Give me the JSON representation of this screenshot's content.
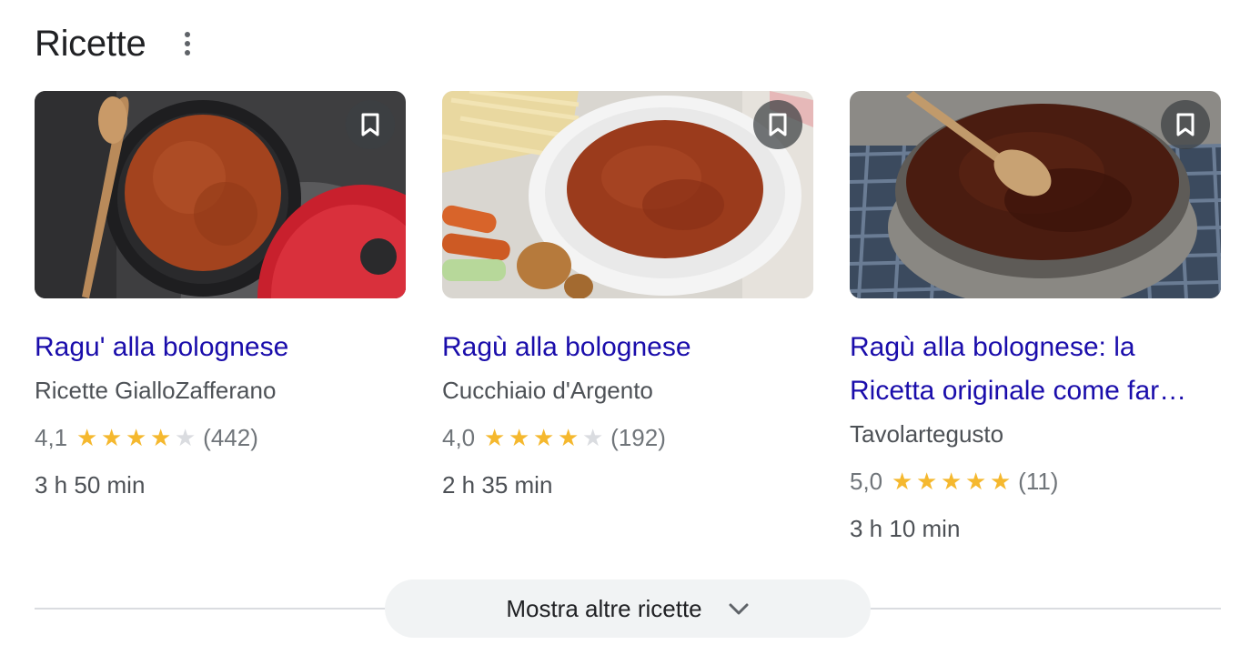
{
  "header": {
    "title": "Ricette",
    "menu_icon": "more-vert-icon"
  },
  "recipes": [
    {
      "title": "Ragu' alla bolognese",
      "source": "Ricette GialloZafferano",
      "rating_text": "4,1",
      "rating_value": 4.1,
      "stars_filled": 4,
      "reviews": "(442)",
      "time": "3 h 50 min",
      "image": "ragu-red-pot-with-wooden-spoon"
    },
    {
      "title": "Ragù alla bolognese",
      "source": "Cucchiaio d'Argento",
      "rating_text": "4,0",
      "rating_value": 4.0,
      "stars_filled": 4,
      "reviews": "(192)",
      "time": "2 h 35 min",
      "image": "ragu-white-dish-with-pasta-and-vegetables"
    },
    {
      "title": "Ragù alla bolognese: la Ricetta originale come far…",
      "source": "Tavolartegusto",
      "rating_text": "5,0",
      "rating_value": 5.0,
      "stars_filled": 5,
      "reviews": "(11)",
      "time": "3 h 10 min",
      "image": "ragu-steel-pot-with-wooden-spoon"
    }
  ],
  "show_more": {
    "label": "Mostra altre ricette",
    "icon": "chevron-down-icon"
  },
  "colors": {
    "link": "#1a0dab",
    "star_on": "#f5b82e",
    "star_off": "#dadce0",
    "secondary_text": "#4d5156"
  }
}
